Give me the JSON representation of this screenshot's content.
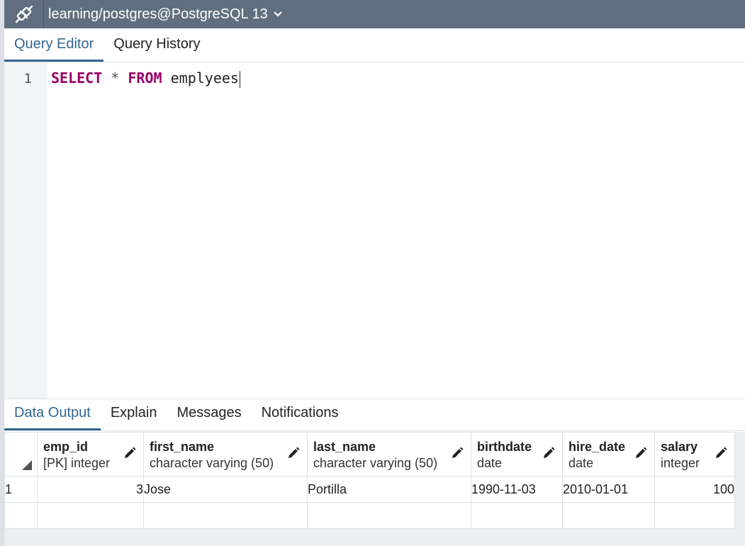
{
  "connection": {
    "title": "learning/postgres@PostgreSQL 13",
    "icon": "plug-connection-icon"
  },
  "editor_tabs": [
    {
      "label": "Query Editor",
      "active": true
    },
    {
      "label": "Query History",
      "active": false
    }
  ],
  "editor": {
    "line_number": "1",
    "code": {
      "kw1": "SELECT",
      "op": "*",
      "kw2": "FROM",
      "ident": "emplyees"
    }
  },
  "output_tabs": [
    {
      "label": "Data Output",
      "active": true
    },
    {
      "label": "Explain",
      "active": false
    },
    {
      "label": "Messages",
      "active": false
    },
    {
      "label": "Notifications",
      "active": false
    }
  ],
  "grid": {
    "columns": [
      {
        "name": "emp_id",
        "type": "[PK] integer"
      },
      {
        "name": "first_name",
        "type": "character varying (50)"
      },
      {
        "name": "last_name",
        "type": "character varying (50)"
      },
      {
        "name": "birthdate",
        "type": "date"
      },
      {
        "name": "hire_date",
        "type": "date"
      },
      {
        "name": "salary",
        "type": "integer"
      }
    ],
    "rows": [
      {
        "row": "1",
        "cells": [
          "3",
          "Jose",
          "Portilla",
          "1990-11-03",
          "2010-01-01",
          "100"
        ]
      }
    ]
  },
  "colors": {
    "topbar": "#5f6f80",
    "accent": "#326690",
    "keyword": "#990066"
  }
}
